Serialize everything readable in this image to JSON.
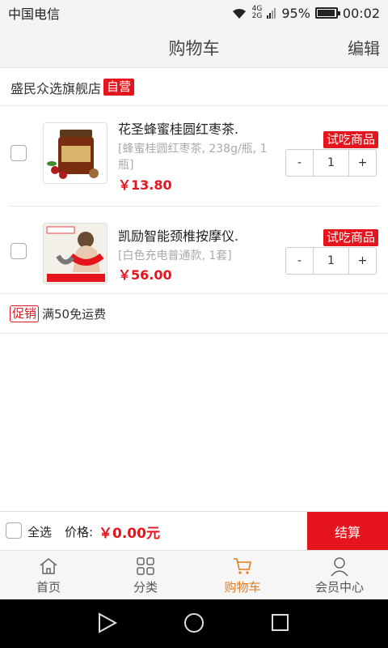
{
  "status": {
    "carrier": "中国电信",
    "net_top": "4G",
    "net_bottom": "2G",
    "battery": "95%",
    "battery_level": 0.95,
    "time": "00:02"
  },
  "header": {
    "title": "购物车",
    "edit": "编辑"
  },
  "shop": {
    "name": "盛民众选旗舰店",
    "badge": "自营"
  },
  "items": [
    {
      "name": "花圣蜂蜜桂圆红枣茶.",
      "spec": "[蜂蜜桂圆红枣茶, 238g/瓶, 1瓶]",
      "price": "￥13.80",
      "tag": "试吃商品",
      "qty": "1",
      "minus": "-",
      "plus": "+"
    },
    {
      "name": "凯励智能颈椎按摩仪.",
      "spec": "[白色充电普通款, 1套]",
      "price": "￥56.00",
      "tag": "试吃商品",
      "qty": "1",
      "minus": "-",
      "plus": "+"
    }
  ],
  "promo": {
    "badge": "促销",
    "text": "满50免运费"
  },
  "checkout": {
    "select_all": "全选",
    "price_label": "价格:",
    "price_value": "￥0.00元",
    "button": "结算"
  },
  "tabs": [
    {
      "label": "首页",
      "icon": "home-icon"
    },
    {
      "label": "分类",
      "icon": "grid-icon"
    },
    {
      "label": "购物车",
      "icon": "cart-icon",
      "active": true
    },
    {
      "label": "会员中心",
      "icon": "user-icon"
    }
  ],
  "colors": {
    "accent": "#e5141d",
    "tab_active": "#e37b1c"
  }
}
